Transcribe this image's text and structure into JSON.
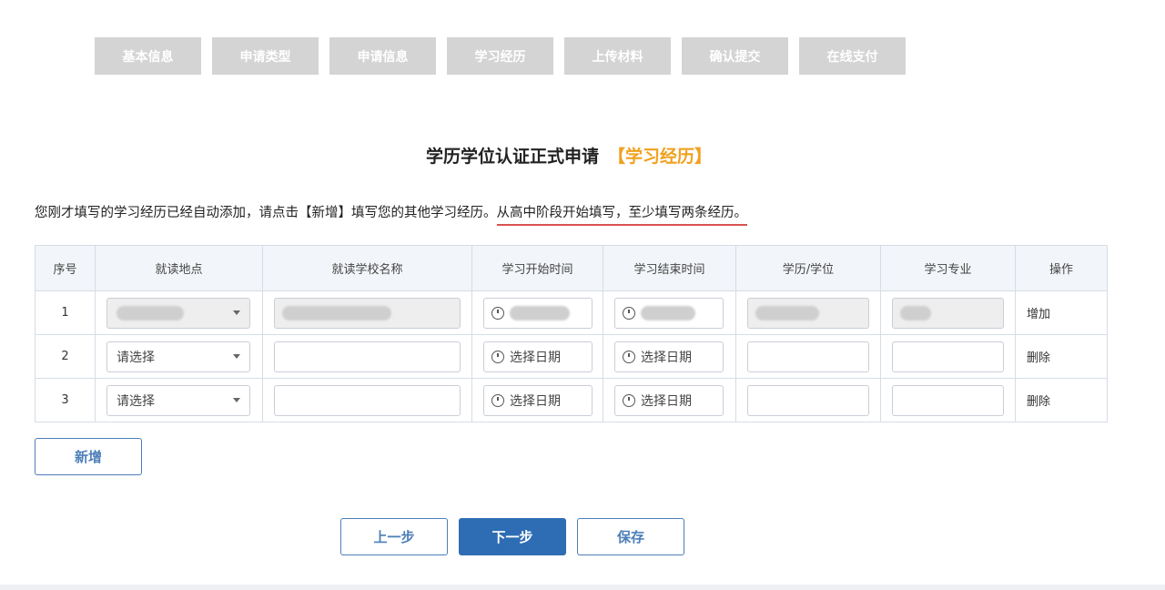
{
  "steps": [
    "基本信息",
    "申请类型",
    "申请信息",
    "学习经历",
    "上传材料",
    "确认提交",
    "在线支付"
  ],
  "title": {
    "main": "学历学位认证正式申请",
    "highlight": "【学习经历】"
  },
  "notice": {
    "part1": "您刚才填写的学习经历已经自动添加，请点击【新增】填写您的其他学习经历。",
    "part2": "从高中阶段开始填写，至少填写两条经历。"
  },
  "table": {
    "headers": [
      "序号",
      "就读地点",
      "就读学校名称",
      "学习开始时间",
      "学习结束时间",
      "学历/学位",
      "学习专业",
      "操作"
    ],
    "rows": [
      {
        "index": "1",
        "location": "",
        "school": "",
        "start": "",
        "end": "",
        "degree": "",
        "major": "",
        "action": "增加"
      },
      {
        "index": "2",
        "location": "请选择",
        "school": "",
        "start": "选择日期",
        "end": "选择日期",
        "degree": "",
        "major": "",
        "action": "删除"
      },
      {
        "index": "3",
        "location": "请选择",
        "school": "",
        "start": "选择日期",
        "end": "选择日期",
        "degree": "",
        "major": "",
        "action": "删除"
      }
    ]
  },
  "buttons": {
    "add": "新增",
    "prev": "上一步",
    "next": "下一步",
    "save": "保存"
  },
  "colors": {
    "primary": "#2e6db4",
    "highlight": "#f0a11e",
    "step_bg": "#d4d4d4",
    "underline": "#d9534f"
  }
}
